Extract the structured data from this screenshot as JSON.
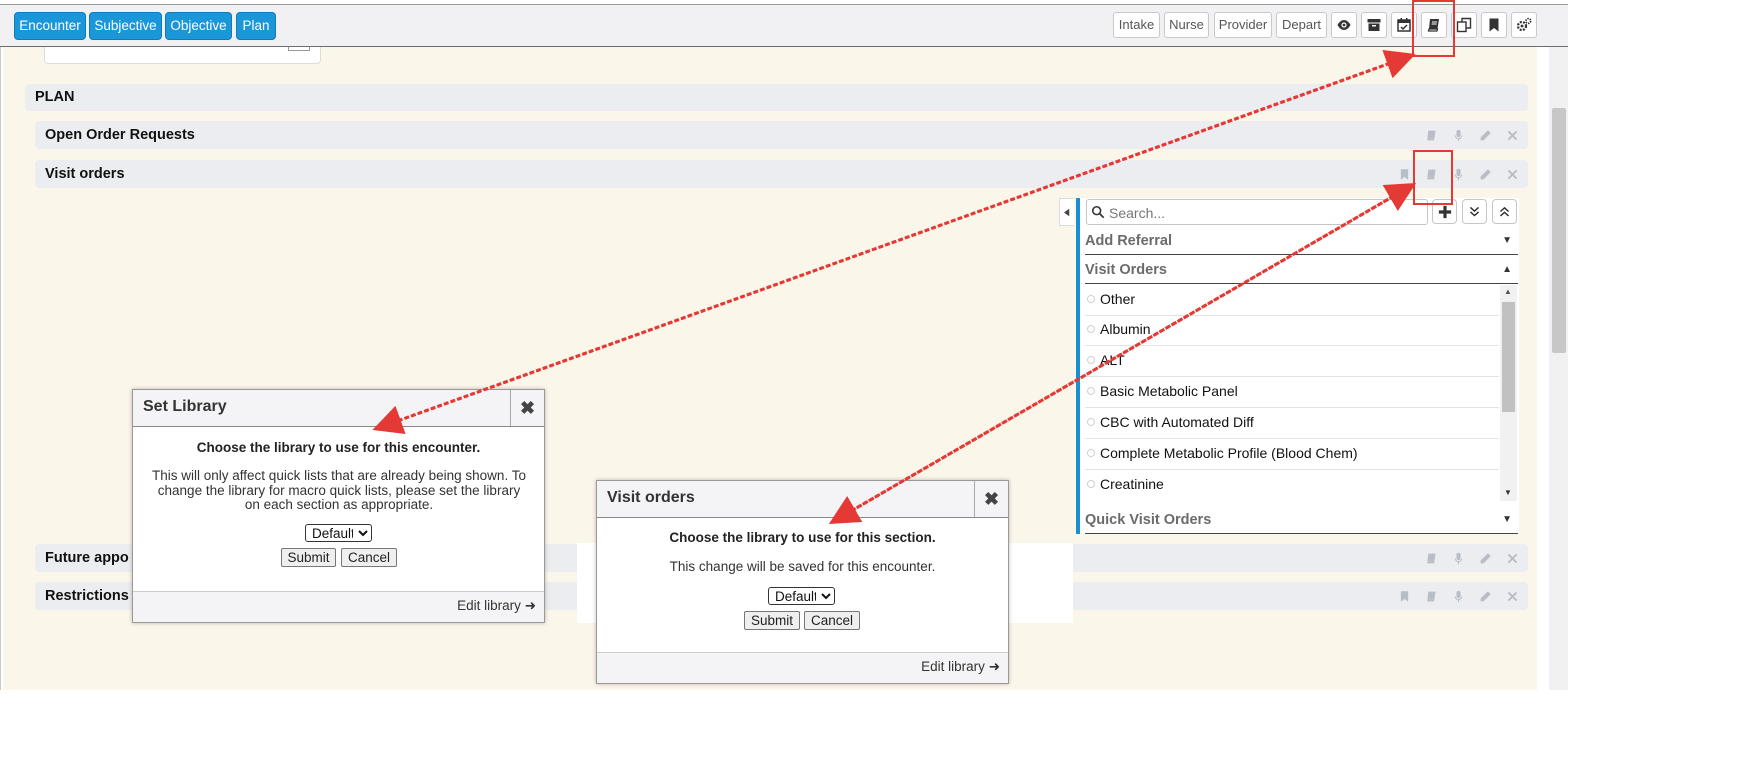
{
  "toolbar": {
    "left_buttons": [
      "Encounter",
      "Subjective",
      "Objective",
      "Plan"
    ],
    "right_buttons": [
      "Intake",
      "Nurse",
      "Provider",
      "Depart"
    ]
  },
  "sections": {
    "plan": "PLAN",
    "open_order_requests": "Open Order Requests",
    "visit_orders": "Visit orders",
    "future_appointments": "Future appo",
    "restrictions": "Restrictions"
  },
  "panel": {
    "search_placeholder": "Search...",
    "groups": {
      "add_referral": "Add Referral",
      "visit_orders": "Visit Orders",
      "quick_visit_orders": "Quick Visit Orders"
    },
    "items": [
      "Other",
      "Albumin",
      "ALT",
      "Basic Metabolic Panel",
      "CBC with Automated Diff",
      "Complete Metabolic Profile (Blood Chem)",
      "Creatinine"
    ]
  },
  "set_library_dialog": {
    "title": "Set Library",
    "heading": "Choose the library to use for this encounter.",
    "body": "This will only affect quick lists that are already being shown. To change the library for macro quick lists, please set the library on each section as appropriate.",
    "select_value": "Default",
    "submit": "Submit",
    "cancel": "Cancel",
    "footer_link": "Edit library"
  },
  "visit_orders_dialog": {
    "title": "Visit orders",
    "heading": "Choose the library to use for this section.",
    "body": "This change will be saved for this encounter.",
    "select_value": "Default",
    "submit": "Submit",
    "cancel": "Cancel",
    "footer_link": "Edit library"
  },
  "colors": {
    "nav_button": "#1a97d8",
    "panel_accent": "#1a8fd3",
    "highlight": "#e53935",
    "content_bg": "#fbf6ea"
  },
  "icons": [
    "eye-icon",
    "archive-icon",
    "calendar-check-icon",
    "book-icon",
    "copy-icon",
    "bookmark-icon",
    "gears-icon",
    "microphone-icon",
    "pencil-icon",
    "close-icon",
    "plus-icon",
    "double-chevron-down-icon",
    "double-chevron-up-icon",
    "search-icon",
    "arrow-right-icon"
  ]
}
